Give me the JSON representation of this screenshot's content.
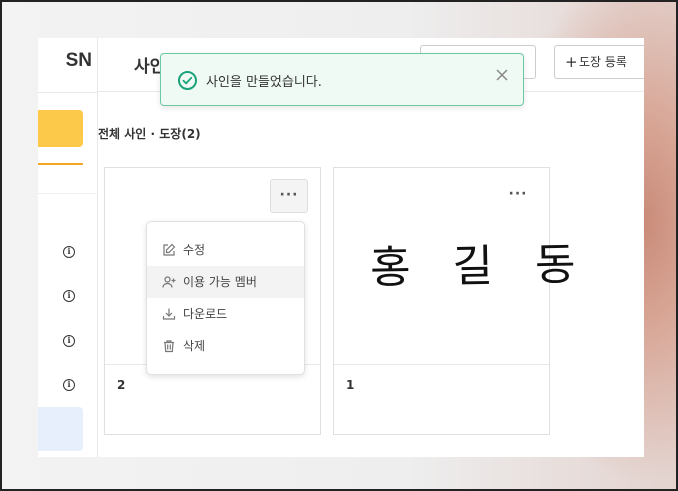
{
  "app": {
    "logo_text": "SN",
    "page_title": "사인",
    "register_stamp_label": "도장 등록",
    "register_stamp_plus": "+"
  },
  "toast": {
    "message": "사인을 만들었습니다.",
    "close_icon": "close-icon",
    "status_icon": "check-circle-icon",
    "accent_color": "#1aa37a"
  },
  "section": {
    "title": "전체 사인 · 도장(2)"
  },
  "cards": [
    {
      "number": "2",
      "more_label": "···"
    },
    {
      "number": "1",
      "more_label": "···",
      "signature_text": "홍 길 동"
    }
  ],
  "menu": {
    "items": [
      {
        "label": "수정",
        "icon": "edit-icon"
      },
      {
        "label": "이용 가능 멤버",
        "icon": "add-member-icon"
      },
      {
        "label": "다운로드",
        "icon": "download-icon"
      },
      {
        "label": "삭제",
        "icon": "trash-icon"
      }
    ]
  },
  "sidebar": {
    "cta_color": "#fdc94a",
    "info_icon_glyph": "i"
  }
}
